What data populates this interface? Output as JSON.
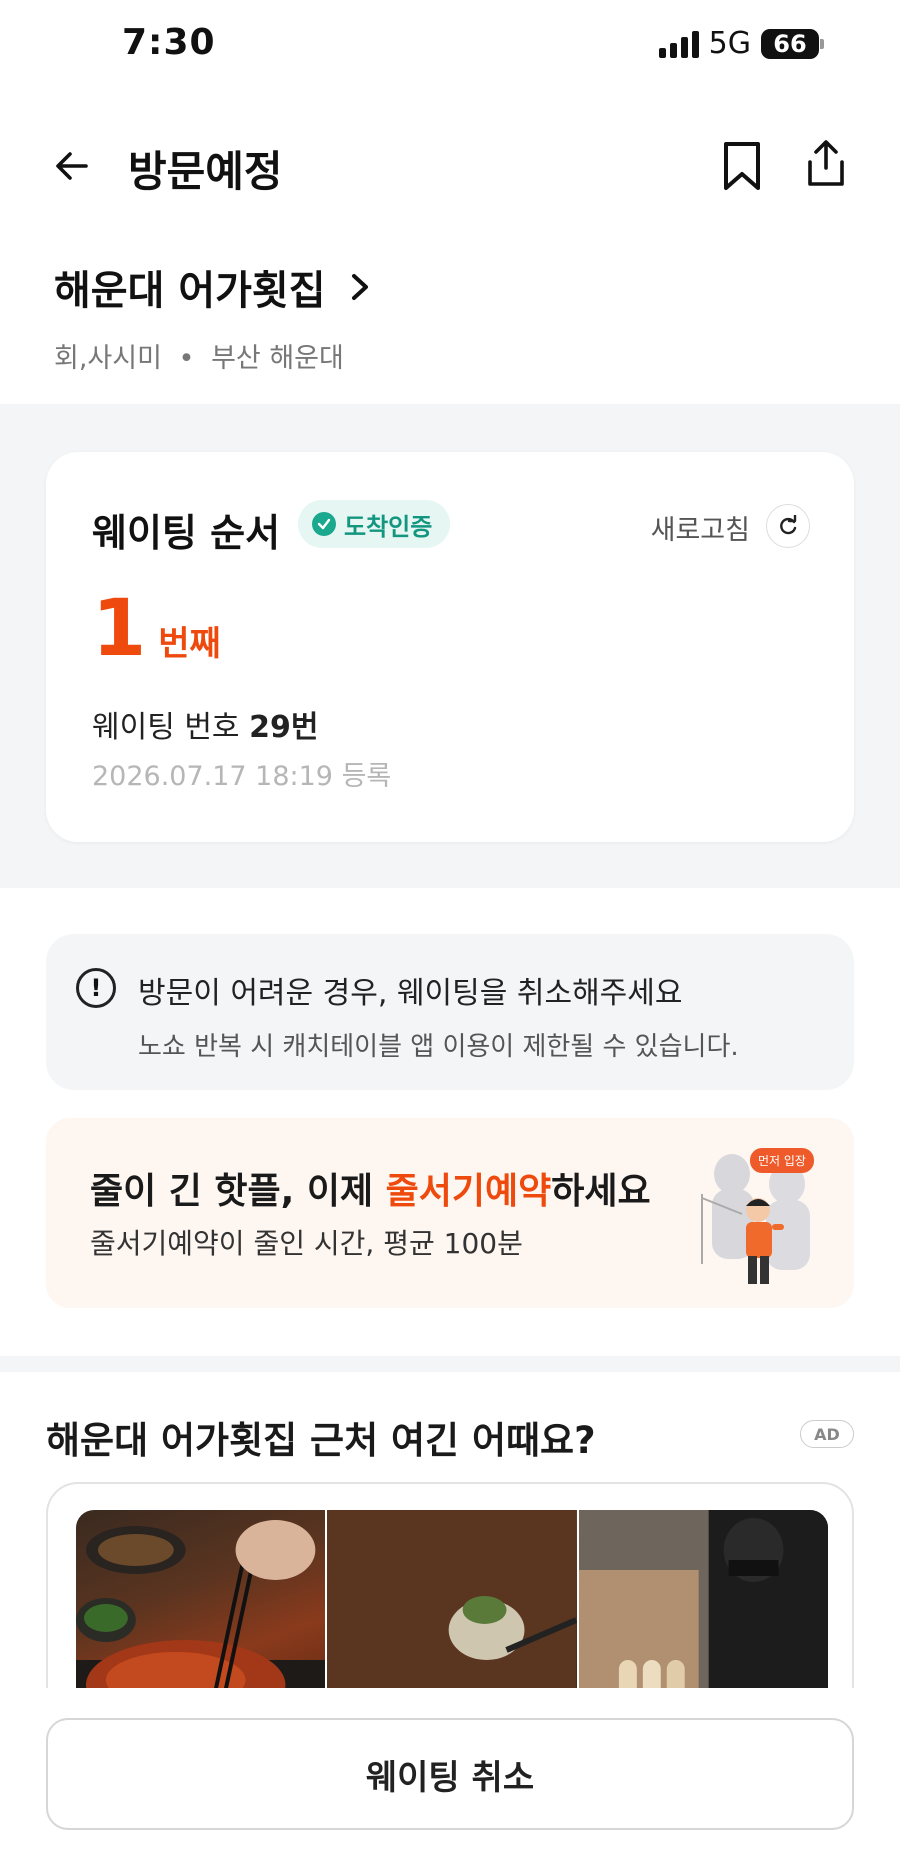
{
  "status_bar": {
    "time": "7:30",
    "network": "5G",
    "battery": "66"
  },
  "header": {
    "title": "방문예정",
    "back_icon": "arrow-left-icon",
    "bookmark_icon": "bookmark-icon",
    "share_icon": "share-icon"
  },
  "restaurant": {
    "name": "해운대 어가횟집",
    "category": "회,사시미",
    "separator": "•",
    "location": "부산 해운대"
  },
  "waiting": {
    "title": "웨이팅 순서",
    "arrival_badge": "도착인증",
    "refresh_label": "새로고침",
    "queue_position": "1",
    "queue_unit": "번째",
    "number_label": "웨이팅 번호",
    "number_value": "29번",
    "registered_at": "2026.07.17 18:19 등록"
  },
  "notice": {
    "title": "방문이 어려운 경우, 웨이팅을 취소해주세요",
    "description": "노쇼 반복 시 캐치테이블 앱 이용이 제한될 수 있습니다."
  },
  "promo": {
    "title_prefix": "줄이 긴 핫플, 이제 ",
    "title_highlight": "줄서기예약",
    "title_suffix": "하세요",
    "subtitle": "줄서기예약이 줄인 시간, 평균 100분",
    "bubble": "먼저 입장"
  },
  "recommendation": {
    "title": "해운대 어가횟집 근처 여긴 어때요?",
    "ad_label": "AD"
  },
  "bottom": {
    "cancel_label": "웨이팅 취소"
  },
  "colors": {
    "accent": "#ee4a0e",
    "arrival_green": "#139680",
    "section_gray": "#f4f5f7"
  }
}
